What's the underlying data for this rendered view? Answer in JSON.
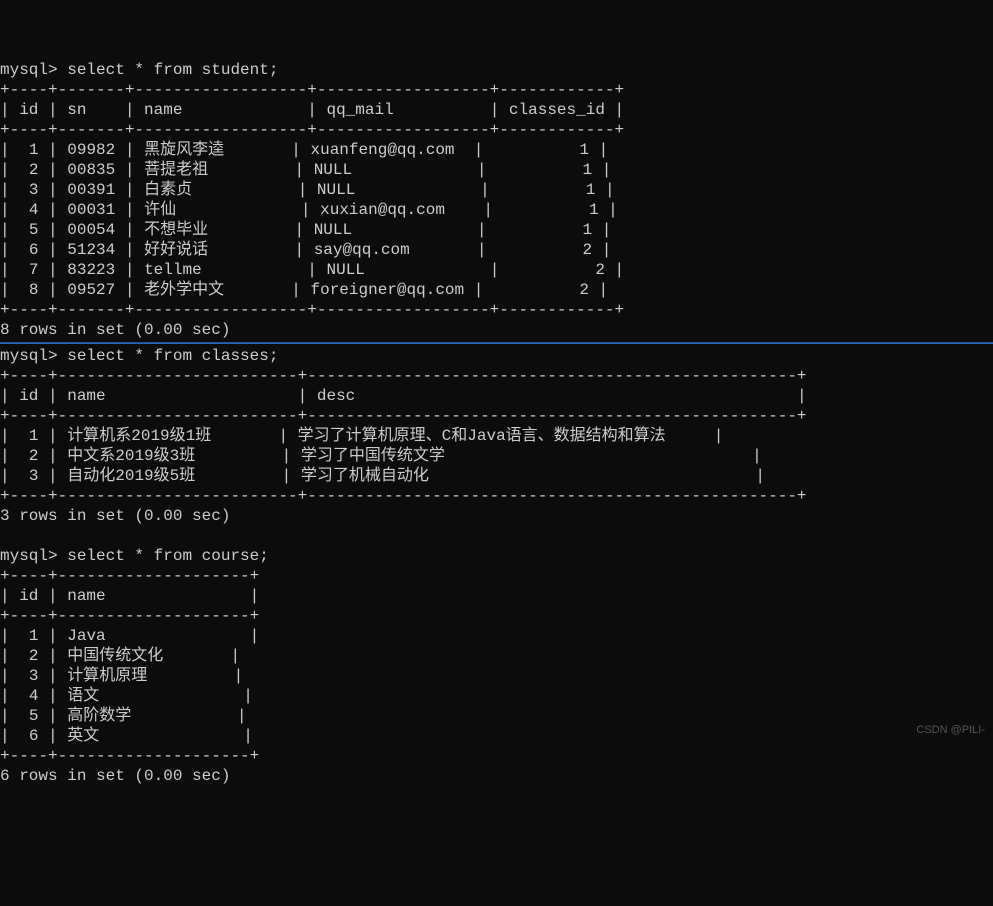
{
  "query1": {
    "prompt": "mysql> ",
    "command": "select * from student;",
    "headers": [
      "id",
      "sn",
      "name",
      "qq_mail",
      "classes_id"
    ],
    "rows": [
      {
        "id": "1",
        "sn": "09982",
        "name": "黑旋风李逵",
        "qq_mail": "xuanfeng@qq.com",
        "classes_id": "1"
      },
      {
        "id": "2",
        "sn": "00835",
        "name": "菩提老祖",
        "qq_mail": "NULL",
        "classes_id": "1"
      },
      {
        "id": "3",
        "sn": "00391",
        "name": "白素贞",
        "qq_mail": "NULL",
        "classes_id": "1"
      },
      {
        "id": "4",
        "sn": "00031",
        "name": "许仙",
        "qq_mail": "xuxian@qq.com",
        "classes_id": "1"
      },
      {
        "id": "5",
        "sn": "00054",
        "name": "不想毕业",
        "qq_mail": "NULL",
        "classes_id": "1"
      },
      {
        "id": "6",
        "sn": "51234",
        "name": "好好说话",
        "qq_mail": "say@qq.com",
        "classes_id": "2"
      },
      {
        "id": "7",
        "sn": "83223",
        "name": "tellme",
        "qq_mail": "NULL",
        "classes_id": "2"
      },
      {
        "id": "8",
        "sn": "09527",
        "name": "老外学中文",
        "qq_mail": "foreigner@qq.com",
        "classes_id": "2"
      }
    ],
    "footer": "8 rows in set (0.00 sec)"
  },
  "query2": {
    "prompt": "mysql> ",
    "command": "select * from classes;",
    "headers": [
      "id",
      "name",
      "desc"
    ],
    "rows": [
      {
        "id": "1",
        "name": "计算机系2019级1班",
        "desc": "学习了计算机原理、C和Java语言、数据结构和算法"
      },
      {
        "id": "2",
        "name": "中文系2019级3班",
        "desc": "学习了中国传统文学"
      },
      {
        "id": "3",
        "name": "自动化2019级5班",
        "desc": "学习了机械自动化"
      }
    ],
    "footer": "3 rows in set (0.00 sec)"
  },
  "query3": {
    "prompt": "mysql> ",
    "command": "select * from course;",
    "headers": [
      "id",
      "name"
    ],
    "rows": [
      {
        "id": "1",
        "name": "Java"
      },
      {
        "id": "2",
        "name": "中国传统文化"
      },
      {
        "id": "3",
        "name": "计算机原理"
      },
      {
        "id": "4",
        "name": "语文"
      },
      {
        "id": "5",
        "name": "高阶数学"
      },
      {
        "id": "6",
        "name": "英文"
      }
    ],
    "footer": "6 rows in set (0.00 sec)"
  },
  "watermark": "CSDN @PILI-"
}
